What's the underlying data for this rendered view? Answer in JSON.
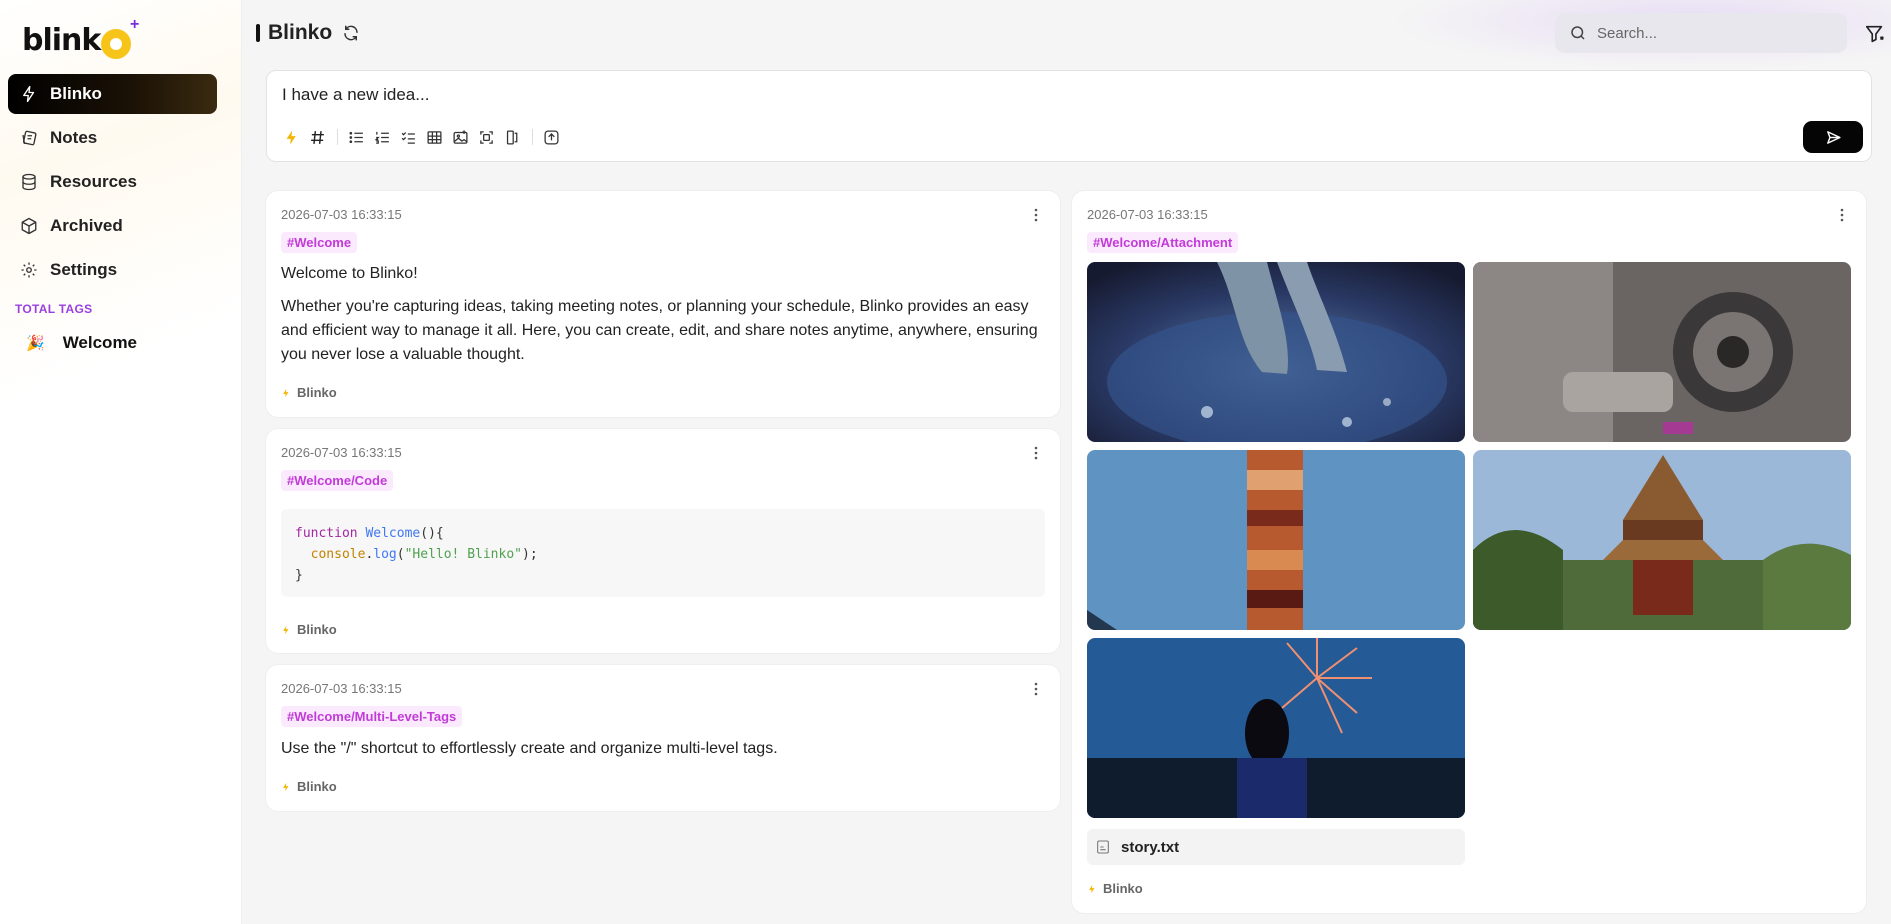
{
  "sidebar": {
    "logo_text": "blink",
    "logo_star": "+",
    "items": [
      {
        "label": "Blinko",
        "icon": "bolt-icon"
      },
      {
        "label": "Notes",
        "icon": "notes-icon"
      },
      {
        "label": "Resources",
        "icon": "database-icon"
      },
      {
        "label": "Archived",
        "icon": "box-icon"
      },
      {
        "label": "Settings",
        "icon": "gear-icon"
      }
    ],
    "tags_heading": "TOTAL TAGS",
    "tags": [
      {
        "emoji": "🎉",
        "label": "Welcome"
      }
    ]
  },
  "header": {
    "title": "Blinko",
    "search_placeholder": "Search..."
  },
  "editor": {
    "placeholder": "I have a new idea..."
  },
  "notes_left": [
    {
      "time": "2026-07-03 16:33:15",
      "tag": "#Welcome",
      "title": "Welcome to Blinko!",
      "body": "Whether you're capturing ideas, taking meeting notes, or planning your schedule, Blinko provides an easy and efficient way to manage it all. Here, you can create, edit, and share notes anytime, anywhere, ensuring you never lose a valuable thought.",
      "footer": "Blinko"
    },
    {
      "time": "2026-07-03 16:33:15",
      "tag": "#Welcome/Code",
      "code": {
        "kw": "function",
        "fn": "Welcome",
        "paren": "(){",
        "obj": "console",
        "dot": ".",
        "method": "log",
        "open": "(",
        "str": "\"Hello! Blinko\"",
        "close": ");",
        "end": "}"
      },
      "footer": "Blinko"
    },
    {
      "time": "2026-07-03 16:33:15",
      "tag": "#Welcome/Multi-Level-Tags",
      "body": "Use the \"/\" shortcut to effortlessly create and organize multi-level tags.",
      "footer": "Blinko"
    }
  ],
  "note_right": {
    "time": "2026-07-03 16:33:15",
    "tag": "#Welcome/Attachment",
    "file_name": "story.txt",
    "footer": "Blinko"
  }
}
